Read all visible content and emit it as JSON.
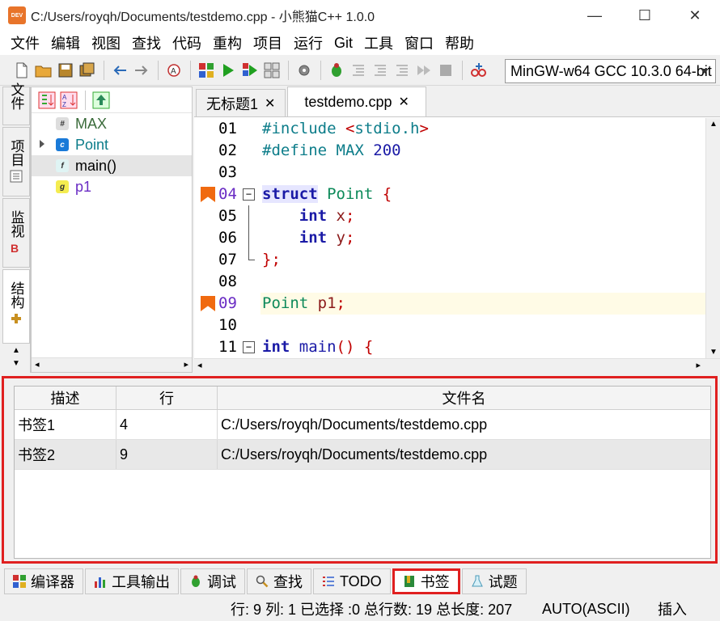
{
  "window": {
    "icon_text": "DEV",
    "title": "C:/Users/royqh/Documents/testdemo.cpp - 小熊猫C++ 1.0.0",
    "minimize": "—",
    "maximize": "☐",
    "close": "✕"
  },
  "menu": [
    "文件",
    "编辑",
    "视图",
    "查找",
    "代码",
    "重构",
    "项目",
    "运行",
    "Git",
    "工具",
    "窗口",
    "帮助"
  ],
  "toolbar": {
    "compiler": "MinGW-w64 GCC 10.3.0 64-bit"
  },
  "left_tabs": [
    {
      "label": "文件"
    },
    {
      "label": "项目"
    },
    {
      "label": "监视"
    },
    {
      "label": "结构"
    }
  ],
  "structure": [
    {
      "badge": "#",
      "name": "MAX",
      "color": "#3a6b3a"
    },
    {
      "badge": "c",
      "name": "Point",
      "color": "#0d7d8a",
      "expandable": true
    },
    {
      "badge": "f",
      "name": "main()",
      "color": "#000000"
    },
    {
      "badge": "g",
      "name": "p1",
      "color": "#6a2cc4"
    }
  ],
  "editor": {
    "tabs": [
      {
        "label": "无标题1",
        "close": "✕"
      },
      {
        "label": "testdemo.cpp",
        "close": "✕"
      }
    ],
    "lines": [
      {
        "n": "01"
      },
      {
        "n": "02"
      },
      {
        "n": "03"
      },
      {
        "n": "04"
      },
      {
        "n": "05"
      },
      {
        "n": "06"
      },
      {
        "n": "07"
      },
      {
        "n": "08"
      },
      {
        "n": "09"
      },
      {
        "n": "10"
      },
      {
        "n": "11"
      }
    ],
    "code": {
      "l1_a": "#include ",
      "l1_b": "<",
      "l1_c": "stdio.h",
      "l1_d": ">",
      "l2_a": "#define MAX ",
      "l2_b": "200",
      "l4_a": "struct",
      "l4_b": " Point ",
      "l4_c": "{",
      "l5_a": "    int",
      "l5_b": " x",
      "l5_c": ";",
      "l6_a": "    int",
      "l6_b": " y",
      "l6_c": ";",
      "l7_a": "};",
      "l9_a": "Point",
      "l9_b": " p1",
      "l9_c": ";",
      "l11_a": "int",
      "l11_b": " main",
      "l11_c": "() {"
    }
  },
  "bookmarks": {
    "headers": [
      "描述",
      "行",
      "文件名"
    ],
    "rows": [
      {
        "desc": "书签1",
        "line": "4",
        "file": "C:/Users/royqh/Documents/testdemo.cpp"
      },
      {
        "desc": "书签2",
        "line": "9",
        "file": "C:/Users/royqh/Documents/testdemo.cpp"
      }
    ]
  },
  "bottom_tabs": [
    "编译器",
    "工具输出",
    "调试",
    "查找",
    "TODO",
    "书签",
    "试题"
  ],
  "status": {
    "position": "行: 9 列: 1 已选择 :0 总行数: 19 总长度: 207",
    "encoding": "AUTO(ASCII)",
    "mode": "插入"
  }
}
